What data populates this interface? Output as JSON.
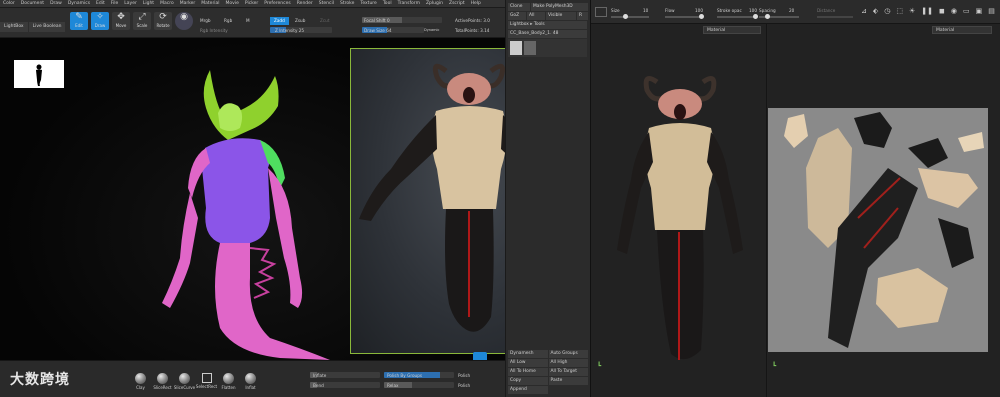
{
  "zbrush": {
    "menu": [
      "Color",
      "Document",
      "Draw",
      "Dynamics",
      "Edit",
      "File",
      "Layer",
      "Light",
      "Macro",
      "Marker",
      "Material",
      "Movie",
      "Picker",
      "Preferences",
      "Render",
      "Stencil",
      "Stroke",
      "Texture",
      "Tool",
      "Transform",
      "Zplugin",
      "Zscript",
      "Help"
    ],
    "tabs": [
      "LightBox",
      "Live Boolean"
    ],
    "tools": [
      {
        "label": "Edit",
        "icon": "✎",
        "active": true
      },
      {
        "label": "Draw",
        "icon": "✧",
        "active": true
      },
      {
        "label": "Move",
        "icon": "✥",
        "active": false
      },
      {
        "label": "Scale",
        "icon": "⤢",
        "active": false
      },
      {
        "label": "Rotate",
        "icon": "⟳",
        "active": false
      }
    ],
    "mrgb": "Mrgb",
    "rgb": "Rgb",
    "m": "M",
    "rgb_intensity": "Rgb Intensity",
    "zadd": "Zadd",
    "zsub": "Zsub",
    "zcut": "Zcut",
    "z_intensity": "Z Intensity 25",
    "focal_shift": "Focal Shift 0",
    "draw_size": "Draw Size 64",
    "dynamic": "Dynamic",
    "active_points": "ActivePoints: 3.0",
    "total_points": "TotalPoints: 3.14",
    "right_panel": {
      "top": [
        "Clone",
        "Make PolyMesh3D",
        "GoZ",
        "All",
        "Visible",
        "R",
        "Lightbox ▸ Tools",
        "CC_Base_Body2_1. 48"
      ],
      "bottom": [
        "Dynamesh",
        "Auto Groups",
        "All Low",
        "All High",
        "All To Home",
        "All To Target",
        "Copy",
        "Paste",
        "Append"
      ]
    },
    "bottom": {
      "brushes": [
        "Clay",
        "SliceRect",
        "SliceCurve",
        "SelectRect",
        "Flatten",
        "Inflat"
      ],
      "inflate": "Inflate",
      "bend": "Bend",
      "polish_by_groups": "Polish By Groups",
      "relax": "Relax",
      "polish": "Polish"
    }
  },
  "painter": {
    "toolbar": {
      "size": "Size",
      "size_value": "10",
      "flow": "Flow",
      "flow_value": "100",
      "stroke_opacity": "Stroke opac",
      "stroke_value": "100",
      "spacing": "Spacing",
      "spacing_value": "20",
      "distance": "Distance"
    },
    "material_3d": "Material",
    "material_2d": "Material"
  },
  "watermark": "大数跨境",
  "colors": {
    "accent": "#1e88d8",
    "viewport_border": "#8ab83a"
  }
}
